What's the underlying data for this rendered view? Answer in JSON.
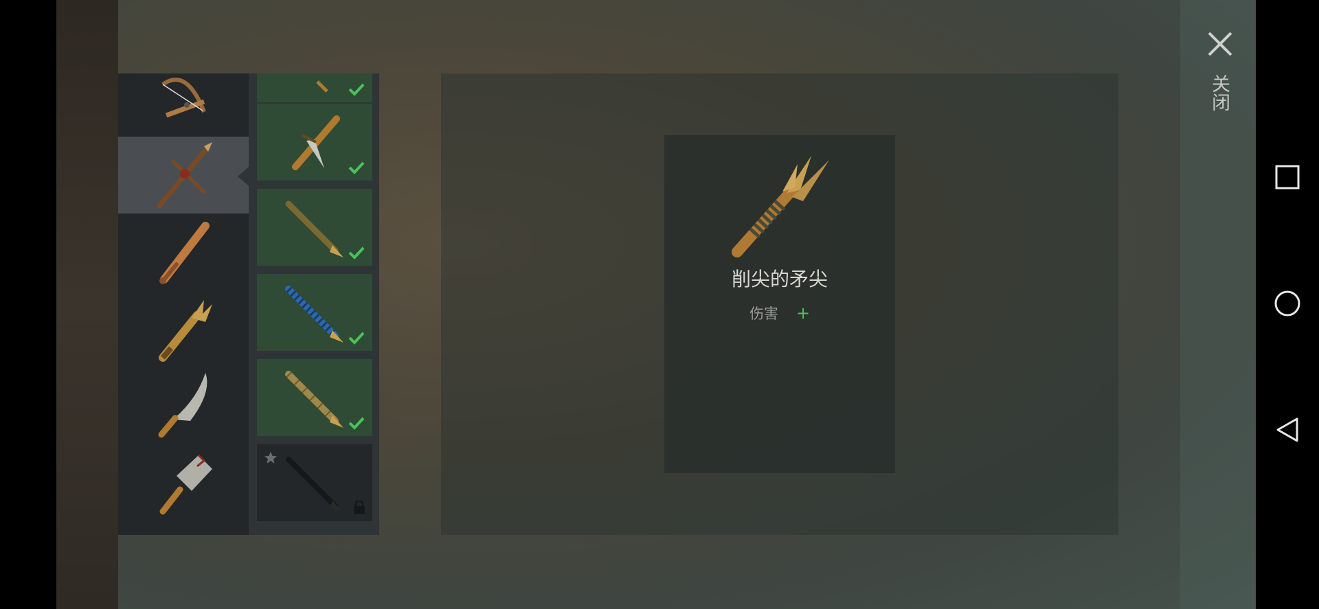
{
  "header": {
    "close_label": "关闭"
  },
  "categories": [
    {
      "icon": "crossbow-icon"
    },
    {
      "icon": "spear-icon",
      "selected": true
    },
    {
      "icon": "bat-icon"
    },
    {
      "icon": "broken-spear-icon"
    },
    {
      "icon": "machete-icon"
    },
    {
      "icon": "cleaver-icon"
    }
  ],
  "items": [
    {
      "icon": "item-icon",
      "status": "check-icon"
    },
    {
      "icon": "knife-spear-icon",
      "status": "check-icon"
    },
    {
      "icon": "wood-spear-icon",
      "status": "check-icon"
    },
    {
      "icon": "blue-spear-icon",
      "status": "check-icon"
    },
    {
      "icon": "bamboo-spear-icon",
      "status": "check-icon"
    },
    {
      "icon": "dark-spear-icon",
      "status": "lock-icon",
      "starred": true
    }
  ],
  "detail": {
    "title": "削尖的矛尖",
    "stat_label": "伤害",
    "stat_value": "+"
  },
  "colors": {
    "accent_green": "#49c25a",
    "unlocked_card": "#2f4b35",
    "locked_card": "#23272a",
    "selected_category": "#4a4e52"
  }
}
